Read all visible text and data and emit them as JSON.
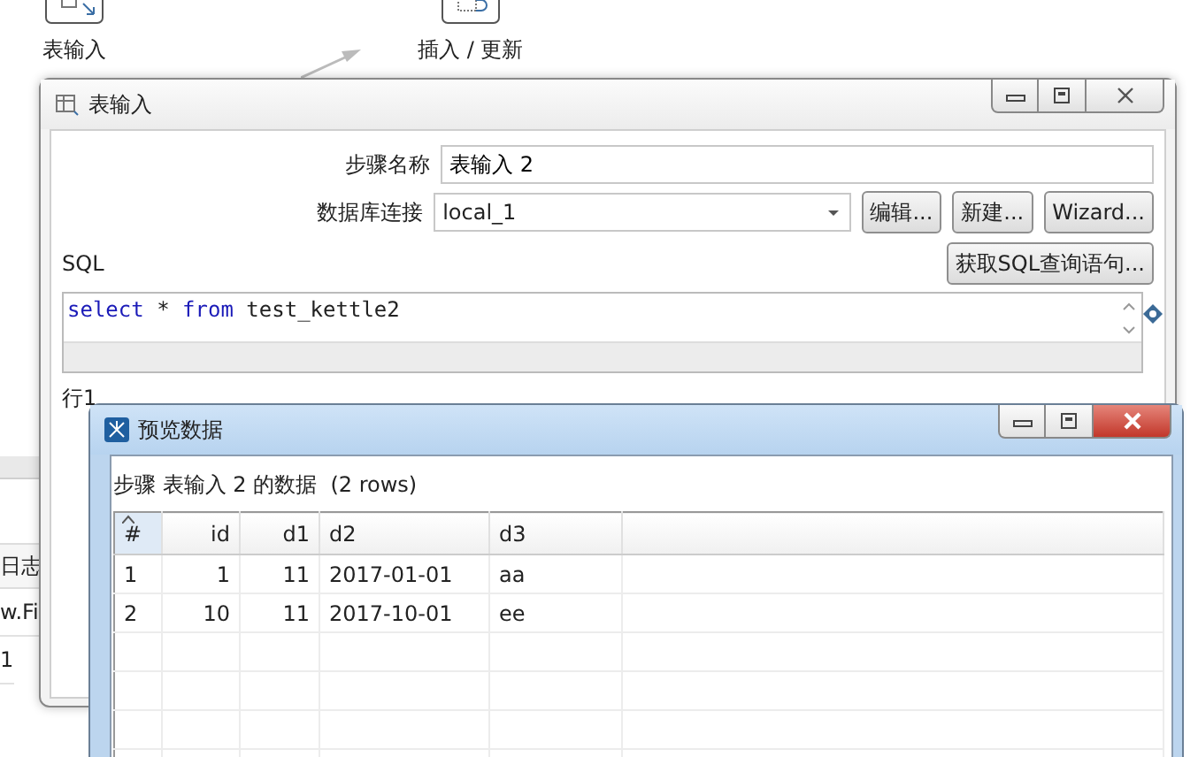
{
  "canvas": {
    "steps": [
      {
        "label": "表输入",
        "kind": "input"
      },
      {
        "label": "插入 / 更新",
        "kind": "update"
      }
    ]
  },
  "background_panel": {
    "tab": "日志",
    "rows": [
      "w.Fi",
      "1"
    ]
  },
  "dialog": {
    "title": "表输入",
    "fields": [
      {
        "label": "步骤名称",
        "kind": "text",
        "value": "表输入 2"
      },
      {
        "label": "数据库连接",
        "kind": "select",
        "value": "local_1",
        "buttons": [
          "编辑...",
          "新建...",
          "Wizard..."
        ]
      }
    ],
    "sql_label": "SQL",
    "get_sql_button": "获取SQL查询语句...",
    "sql": [
      {
        "kind": "keyword",
        "text": "select"
      },
      {
        "kind": "plain",
        "text": " * "
      },
      {
        "kind": "keyword",
        "text": "from"
      },
      {
        "kind": "plain",
        "text": " test_kettle2"
      }
    ],
    "cursor_position": "行1"
  },
  "preview": {
    "title": "预览数据",
    "caption": "步骤 表输入 2 的数据  (2 rows)",
    "table": {
      "columns": [
        {
          "label": "#",
          "kind": "index",
          "sorted": true
        },
        {
          "label": "id",
          "kind": "number",
          "sorted": false
        },
        {
          "label": "d1",
          "kind": "number",
          "sorted": false
        },
        {
          "label": "d2",
          "kind": "text",
          "sorted": false
        },
        {
          "label": "d3",
          "kind": "text",
          "sorted": false
        }
      ],
      "rows": [
        [
          "1",
          "1",
          "11",
          "2017-01-01",
          "aa"
        ],
        [
          "2",
          "10",
          "11",
          "2017-10-01",
          "ee"
        ]
      ]
    }
  }
}
